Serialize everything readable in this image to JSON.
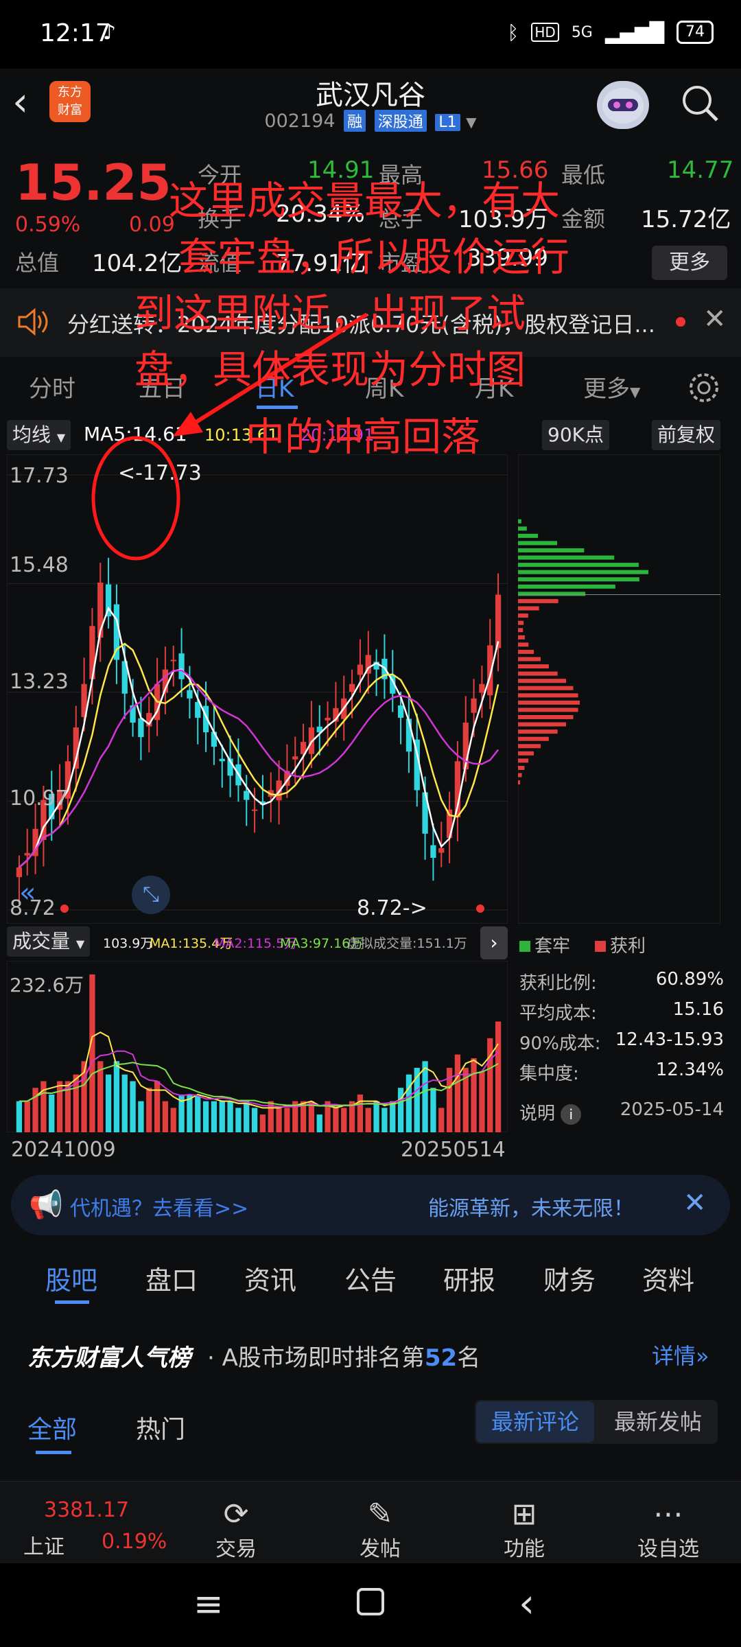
{
  "status_bar": {
    "time": "12:17",
    "battery": "74",
    "network": "5G"
  },
  "header": {
    "app_logo": "东方\n财富",
    "stock_name": "武汉凡谷",
    "stock_code": "002194",
    "tags": [
      "融",
      "深股通",
      "L1"
    ]
  },
  "quote": {
    "price": "15.25",
    "change_pct": "0.59%",
    "change_amt": "0.09",
    "fields": {
      "open_label": "今开",
      "open": "14.91",
      "high_label": "最高",
      "high": "15.66",
      "low_label": "最低",
      "low": "14.77",
      "turnover_label": "换手",
      "turnover": "20.34%",
      "volume_label": "总手",
      "volume": "103.9万",
      "amount_label": "金额",
      "amount": "15.72亿",
      "mktcap_label": "总值",
      "mktcap": "104.2亿",
      "float_label": "流值",
      "float": "77.91亿",
      "pe_label": "市盈",
      "pe": "339.99"
    },
    "more": "更多"
  },
  "notice": {
    "text": "分红送转：2024年度分配10派0.70元(含税)，股权登记日..."
  },
  "period_tabs": [
    "分时",
    "五日",
    "日K",
    "周K",
    "月K",
    "更多"
  ],
  "period_active": 2,
  "chart_toolbar": {
    "ma_selector": "均线",
    "ma5": "MA5:14.61",
    "ma10": "10:13.61",
    "ma20": "20:12.91",
    "chip_selector": "90K点",
    "adjust": "前复权"
  },
  "chart_data": {
    "type": "candlestick",
    "y_ticks": [
      "17.73",
      "15.48",
      "13.23",
      "10.97",
      "8.72"
    ],
    "ylim": [
      8.72,
      17.73
    ],
    "max_label": "<-17.73",
    "min_label": "8.72->",
    "close": [
      9.6,
      9.9,
      10.4,
      11.0,
      10.6,
      11.2,
      11.8,
      12.5,
      13.4,
      14.6,
      15.5,
      14.8,
      13.9,
      13.2,
      12.6,
      12.3,
      12.8,
      13.4,
      13.7,
      13.9,
      13.5,
      13.1,
      12.7,
      12.4,
      12.1,
      11.8,
      11.5,
      11.3,
      11.0,
      10.8,
      10.9,
      11.2,
      11.4,
      11.6,
      11.9,
      12.2,
      12.5,
      12.4,
      12.7,
      12.9,
      13.1,
      13.4,
      13.8,
      14.0,
      13.7,
      13.5,
      13.2,
      12.7,
      12.0,
      11.2,
      10.3,
      9.8,
      10.0,
      10.8,
      11.8,
      12.6,
      13.1,
      13.4,
      14.2,
      15.25
    ],
    "colors": {
      "up": "#e33e3e",
      "down": "#2fd6e0",
      "ma5": "#ffffff",
      "ma10": "#ffe84a",
      "ma20": "#d236d9"
    },
    "chip_profile": {
      "unit_rows": "price levels",
      "profit_color": "#e33e3e",
      "trapped_color": "#2bb53b"
    }
  },
  "volume": {
    "selector": "成交量",
    "vol": "103.9万",
    "ma1": "MA1:135.4万",
    "ma2": "MA2:115.5万",
    "ma3": "MA3:97.16万",
    "virtual": "虚拟成交量:151.1万",
    "max_label": "232.6万",
    "start_date": "20241009",
    "end_date": "20250514"
  },
  "chip_stats": {
    "legend_trapped": "套牢",
    "legend_profit": "获利",
    "profit_ratio_label": "获利比例:",
    "profit_ratio": "60.89%",
    "avg_cost_label": "平均成本:",
    "avg_cost": "15.16",
    "cost90_label": "90%成本:",
    "cost90": "12.43-15.93",
    "concentration_label": "集中度:",
    "concentration": "12.34%",
    "note_label": "说明",
    "date": "2025-05-14"
  },
  "ad": {
    "left": "代机遇？去看看>>",
    "right": "能源革新，未来无限！"
  },
  "bottom_tabs": [
    "股吧",
    "盘口",
    "资讯",
    "公告",
    "研报",
    "财务",
    "资料"
  ],
  "rank": {
    "title": "东方财富人气榜",
    "desc": "· A股市场即时排名第",
    "num": "52",
    "suffix": "名",
    "detail": "详情"
  },
  "feed_tabs": {
    "all": "全部",
    "hot": "热门",
    "latest_comment": "最新评论",
    "latest_post": "最新发帖"
  },
  "bottom_nav": {
    "index_value": "3381.17",
    "index_name": "上证",
    "index_pct": "0.19%",
    "items": [
      "交易",
      "发帖",
      "功能",
      "设自选"
    ]
  },
  "annotation": {
    "lines": [
      "这里成交量最大，有大",
      "套牢盘，所以股价运行",
      "到这里附近，出现了试",
      "盘，具体表现为分时图",
      "中的冲高回落"
    ],
    "color": "#ff2a2a"
  }
}
